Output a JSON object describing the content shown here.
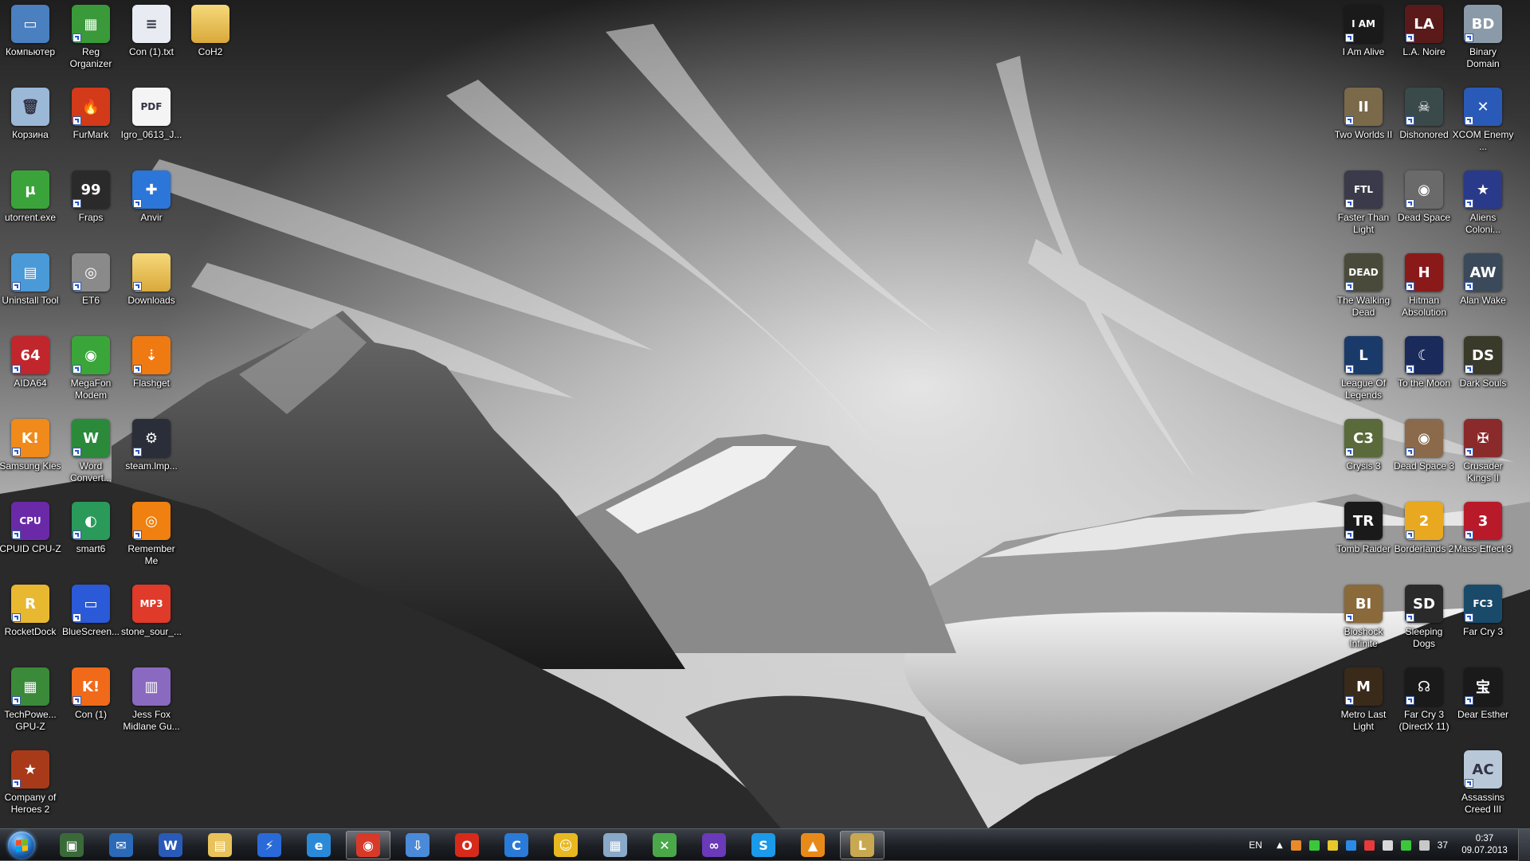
{
  "desktop": {
    "left_icons": [
      {
        "label": "Компьютер",
        "icon": "computer-icon",
        "color": "#4a7fc0",
        "glyph": "▭",
        "shortcut": false
      },
      {
        "label": "Reg Organizer",
        "icon": "reg-organizer-icon",
        "color": "#3a9a3a",
        "glyph": "▦",
        "shortcut": true
      },
      {
        "label": "Con (1).txt",
        "icon": "text-file-icon",
        "color": "#e8ecf2",
        "glyph": "≡",
        "shortcut": false
      },
      {
        "label": "CoH2",
        "icon": "folder-icon",
        "color": "#e8c25a",
        "glyph": "",
        "shortcut": false
      },
      {
        "label": "Корзина",
        "icon": "recycle-bin-icon",
        "color": "#9bb8d6",
        "glyph": "🗑",
        "shortcut": false
      },
      {
        "label": "FurMark",
        "icon": "furmark-icon",
        "color": "#d23a1a",
        "glyph": "🔥",
        "shortcut": true
      },
      {
        "label": "Igro_0613_J...",
        "icon": "pdf-file-icon",
        "color": "#f4f4f4",
        "glyph": "PDF",
        "shortcut": false
      },
      {
        "label": "utorrent.exe",
        "icon": "utorrent-icon",
        "color": "#3aa43a",
        "glyph": "µ",
        "shortcut": false
      },
      {
        "label": "Fraps",
        "icon": "fraps-icon",
        "color": "#2a2a2a",
        "glyph": "99",
        "shortcut": true
      },
      {
        "label": "Anvir",
        "icon": "anvir-icon",
        "color": "#2b76d8",
        "glyph": "✚",
        "shortcut": true
      },
      {
        "label": "Uninstall Tool",
        "icon": "uninstall-tool-icon",
        "color": "#4a9ad8",
        "glyph": "▤",
        "shortcut": true
      },
      {
        "label": "ET6",
        "icon": "et6-icon",
        "color": "#8a8a8a",
        "glyph": "◎",
        "shortcut": true
      },
      {
        "label": "Downloads",
        "icon": "downloads-folder-icon",
        "color": "#e8c25a",
        "glyph": "",
        "shortcut": true
      },
      {
        "label": "AIDA64",
        "icon": "aida64-icon",
        "color": "#c0262c",
        "glyph": "64",
        "shortcut": true
      },
      {
        "label": "MegaFon Modem",
        "icon": "megafon-icon",
        "color": "#3aa63a",
        "glyph": "◉",
        "shortcut": true
      },
      {
        "label": "Flashget",
        "icon": "flashget-icon",
        "color": "#f07a12",
        "glyph": "⇣",
        "shortcut": true
      },
      {
        "label": "Samsung Kies",
        "icon": "samsung-kies-icon",
        "color": "#f08a1a",
        "glyph": "K!",
        "shortcut": true
      },
      {
        "label": "Word Convert...",
        "icon": "word-converter-icon",
        "color": "#2a8a3a",
        "glyph": "W",
        "shortcut": true
      },
      {
        "label": "steam.lmp...",
        "icon": "steam-icon",
        "color": "#2a2e38",
        "glyph": "⚙",
        "shortcut": true
      },
      {
        "label": "CPUID CPU-Z",
        "icon": "cpuz-icon",
        "color": "#6a2aa8",
        "glyph": "CPU",
        "shortcut": true
      },
      {
        "label": "smart6",
        "icon": "smart6-icon",
        "color": "#2a9a5a",
        "glyph": "◐",
        "shortcut": true
      },
      {
        "label": "Remember Me",
        "icon": "remember-me-icon",
        "color": "#f08010",
        "glyph": "◎",
        "shortcut": true
      },
      {
        "label": "RocketDock",
        "icon": "rocketdock-icon",
        "color": "#e8b830",
        "glyph": "R",
        "shortcut": true
      },
      {
        "label": "BlueScreen...",
        "icon": "bluescreen-icon",
        "color": "#2a5ad8",
        "glyph": "▭",
        "shortcut": true
      },
      {
        "label": "stone_sour_...",
        "icon": "mp3-file-icon",
        "color": "#e03a2a",
        "glyph": "MP3",
        "shortcut": false
      },
      {
        "label": "TechPowe... GPU-Z",
        "icon": "gpuz-icon",
        "color": "#3a8a3a",
        "glyph": "▦",
        "shortcut": true
      },
      {
        "label": "Con (1)",
        "icon": "kies-lite-icon",
        "color": "#f06a1a",
        "glyph": "K!",
        "shortcut": true
      },
      {
        "label": "Jess Fox Midlane Gu...",
        "icon": "document-icon",
        "color": "#8a6ac0",
        "glyph": "▥",
        "shortcut": false
      },
      {
        "label": "Company of Heroes 2",
        "icon": "company-of-heroes-2-icon",
        "color": "#a83a1a",
        "glyph": "★",
        "shortcut": true
      }
    ],
    "right_icons": [
      {
        "label": "I Am Alive",
        "icon": "i-am-alive-icon",
        "color": "#1a1a1a",
        "glyph": "I AM",
        "shortcut": true
      },
      {
        "label": "L.A. Noire",
        "icon": "la-noire-icon",
        "color": "#5a1a1a",
        "glyph": "LA",
        "shortcut": true
      },
      {
        "label": "Binary Domain",
        "icon": "binary-domain-icon",
        "color": "#8a9aa8",
        "glyph": "BD",
        "shortcut": true
      },
      {
        "label": "Two Worlds II",
        "icon": "two-worlds-2-icon",
        "color": "#7a6a4a",
        "glyph": "II",
        "shortcut": true
      },
      {
        "label": "Dishonored",
        "icon": "dishonored-icon",
        "color": "#3a4a4a",
        "glyph": "☠",
        "shortcut": true
      },
      {
        "label": "XCOM Enemy ...",
        "icon": "xcom-icon",
        "color": "#2a5ab8",
        "glyph": "✕",
        "shortcut": true
      },
      {
        "label": "Faster Than Light",
        "icon": "ftl-icon",
        "color": "#3a3a4a",
        "glyph": "FTL",
        "shortcut": true
      },
      {
        "label": "Dead Space",
        "icon": "dead-space-icon",
        "color": "#6a6a6a",
        "glyph": "◉",
        "shortcut": true
      },
      {
        "label": "Aliens Coloni...",
        "icon": "aliens-colonial-marines-icon",
        "color": "#2a3a8a",
        "glyph": "★",
        "shortcut": true
      },
      {
        "label": "The Walking Dead",
        "icon": "walking-dead-icon",
        "color": "#4a4a3a",
        "glyph": "DEAD",
        "shortcut": true
      },
      {
        "label": "Hitman Absolution",
        "icon": "hitman-icon",
        "color": "#8a1a1a",
        "glyph": "H",
        "shortcut": true
      },
      {
        "label": "Alan Wake",
        "icon": "alan-wake-icon",
        "color": "#3a4a5a",
        "glyph": "AW",
        "shortcut": true
      },
      {
        "label": "League Of Legends",
        "icon": "league-of-legends-icon",
        "color": "#1a3a6a",
        "glyph": "L",
        "shortcut": true
      },
      {
        "label": "To the Moon",
        "icon": "to-the-moon-icon",
        "color": "#1a2a5a",
        "glyph": "☾",
        "shortcut": true
      },
      {
        "label": "Dark Souls",
        "icon": "dark-souls-icon",
        "color": "#3a3a2a",
        "glyph": "DS",
        "shortcut": true
      },
      {
        "label": "Crysis 3",
        "icon": "crysis-3-icon",
        "color": "#5a6a3a",
        "glyph": "C3",
        "shortcut": true
      },
      {
        "label": "Dead Space 3",
        "icon": "dead-space-3-icon",
        "color": "#8a6a4a",
        "glyph": "◉",
        "shortcut": true
      },
      {
        "label": "Crusader Kings II",
        "icon": "crusader-kings-2-icon",
        "color": "#8a2a2a",
        "glyph": "✠",
        "shortcut": true
      },
      {
        "label": "Tomb Raider",
        "icon": "tomb-raider-icon",
        "color": "#1a1a1a",
        "glyph": "TR",
        "shortcut": true
      },
      {
        "label": "Borderlands 2",
        "icon": "borderlands-2-icon",
        "color": "#e8a820",
        "glyph": "2",
        "shortcut": true
      },
      {
        "label": "Mass Effect 3",
        "icon": "mass-effect-3-icon",
        "color": "#b81a2a",
        "glyph": "3",
        "shortcut": true
      },
      {
        "label": "Bioshock Infinite",
        "icon": "bioshock-infinite-icon",
        "color": "#8a6a3a",
        "glyph": "BI",
        "shortcut": true
      },
      {
        "label": "Sleeping Dogs",
        "icon": "sleeping-dogs-icon",
        "color": "#2a2a2a",
        "glyph": "SD",
        "shortcut": true
      },
      {
        "label": "Far Cry 3",
        "icon": "far-cry-3-icon",
        "color": "#1a4a6a",
        "glyph": "FC3",
        "shortcut": true
      },
      {
        "label": "Metro Last Light",
        "icon": "metro-last-light-icon",
        "color": "#3a2a1a",
        "glyph": "M",
        "shortcut": true
      },
      {
        "label": "Far Cry 3 (DirectX 11)",
        "icon": "far-cry-3-dx11-icon",
        "color": "#1a1a1a",
        "glyph": "☊",
        "shortcut": true
      },
      {
        "label": "Dear Esther",
        "icon": "dear-esther-icon",
        "color": "#1a1a1a",
        "glyph": "宝",
        "shortcut": true
      },
      {
        "label": "Assassins Creed III",
        "icon": "assassins-creed-3-icon",
        "color": "#b8c8d8",
        "glyph": "AC",
        "shortcut": true
      }
    ]
  },
  "taskbar": {
    "start_label": "Start",
    "buttons": [
      {
        "icon": "task-manager-icon",
        "color": "#3a6a3a",
        "glyph": "▣",
        "active": false
      },
      {
        "icon": "thunderbird-icon",
        "color": "#2a6ab8",
        "glyph": "✉",
        "active": false
      },
      {
        "icon": "word-icon",
        "color": "#2a5ab8",
        "glyph": "W",
        "active": false
      },
      {
        "icon": "explorer-icon",
        "color": "#e8c25a",
        "glyph": "▤",
        "active": false
      },
      {
        "icon": "winamp-icon",
        "color": "#2a6ad8",
        "glyph": "⚡",
        "active": false
      },
      {
        "icon": "internet-explorer-icon",
        "color": "#2a8ad8",
        "glyph": "e",
        "active": false
      },
      {
        "icon": "chrome-icon",
        "color": "#d83a2a",
        "glyph": "◉",
        "active": true
      },
      {
        "icon": "mail-agent-icon",
        "color": "#4a8ad8",
        "glyph": "⇩",
        "active": false
      },
      {
        "icon": "opera-icon",
        "color": "#d82a1a",
        "glyph": "O",
        "active": false
      },
      {
        "icon": "ccleaner-icon",
        "color": "#2a7ad8",
        "glyph": "C",
        "active": false
      },
      {
        "icon": "qip-icon",
        "color": "#e8b820",
        "glyph": "☺",
        "active": false
      },
      {
        "icon": "calculator-icon",
        "color": "#8aa8c8",
        "glyph": "▦",
        "active": false
      },
      {
        "icon": "xbox-icon",
        "color": "#4aa84a",
        "glyph": "✕",
        "active": false
      },
      {
        "icon": "visual-studio-icon",
        "color": "#6a3ab8",
        "glyph": "∞",
        "active": false
      },
      {
        "icon": "skype-icon",
        "color": "#1a9ae8",
        "glyph": "S",
        "active": false
      },
      {
        "icon": "origin-icon",
        "color": "#e88a1a",
        "glyph": "▲",
        "active": false
      },
      {
        "icon": "league-of-legends-taskbar-icon",
        "color": "#c8a850",
        "glyph": "L",
        "active": true
      }
    ],
    "tray": {
      "language": "EN",
      "icons": [
        {
          "icon": "tray-orange-icon",
          "color": "#e88a2a"
        },
        {
          "icon": "tray-green-icon",
          "color": "#3ac83a"
        },
        {
          "icon": "tray-yellow-icon",
          "color": "#e8c82a"
        },
        {
          "icon": "tray-blue-icon",
          "color": "#2a8ae8"
        },
        {
          "icon": "tray-red-icon",
          "color": "#e83a3a"
        },
        {
          "icon": "volume-icon",
          "color": "#d8d8d8"
        },
        {
          "icon": "signal-icon",
          "color": "#3ac83a"
        },
        {
          "icon": "network-icon",
          "color": "#c8c8c8"
        }
      ],
      "battery_value": "37",
      "time": "0:37",
      "date": "09.07.2013"
    }
  }
}
